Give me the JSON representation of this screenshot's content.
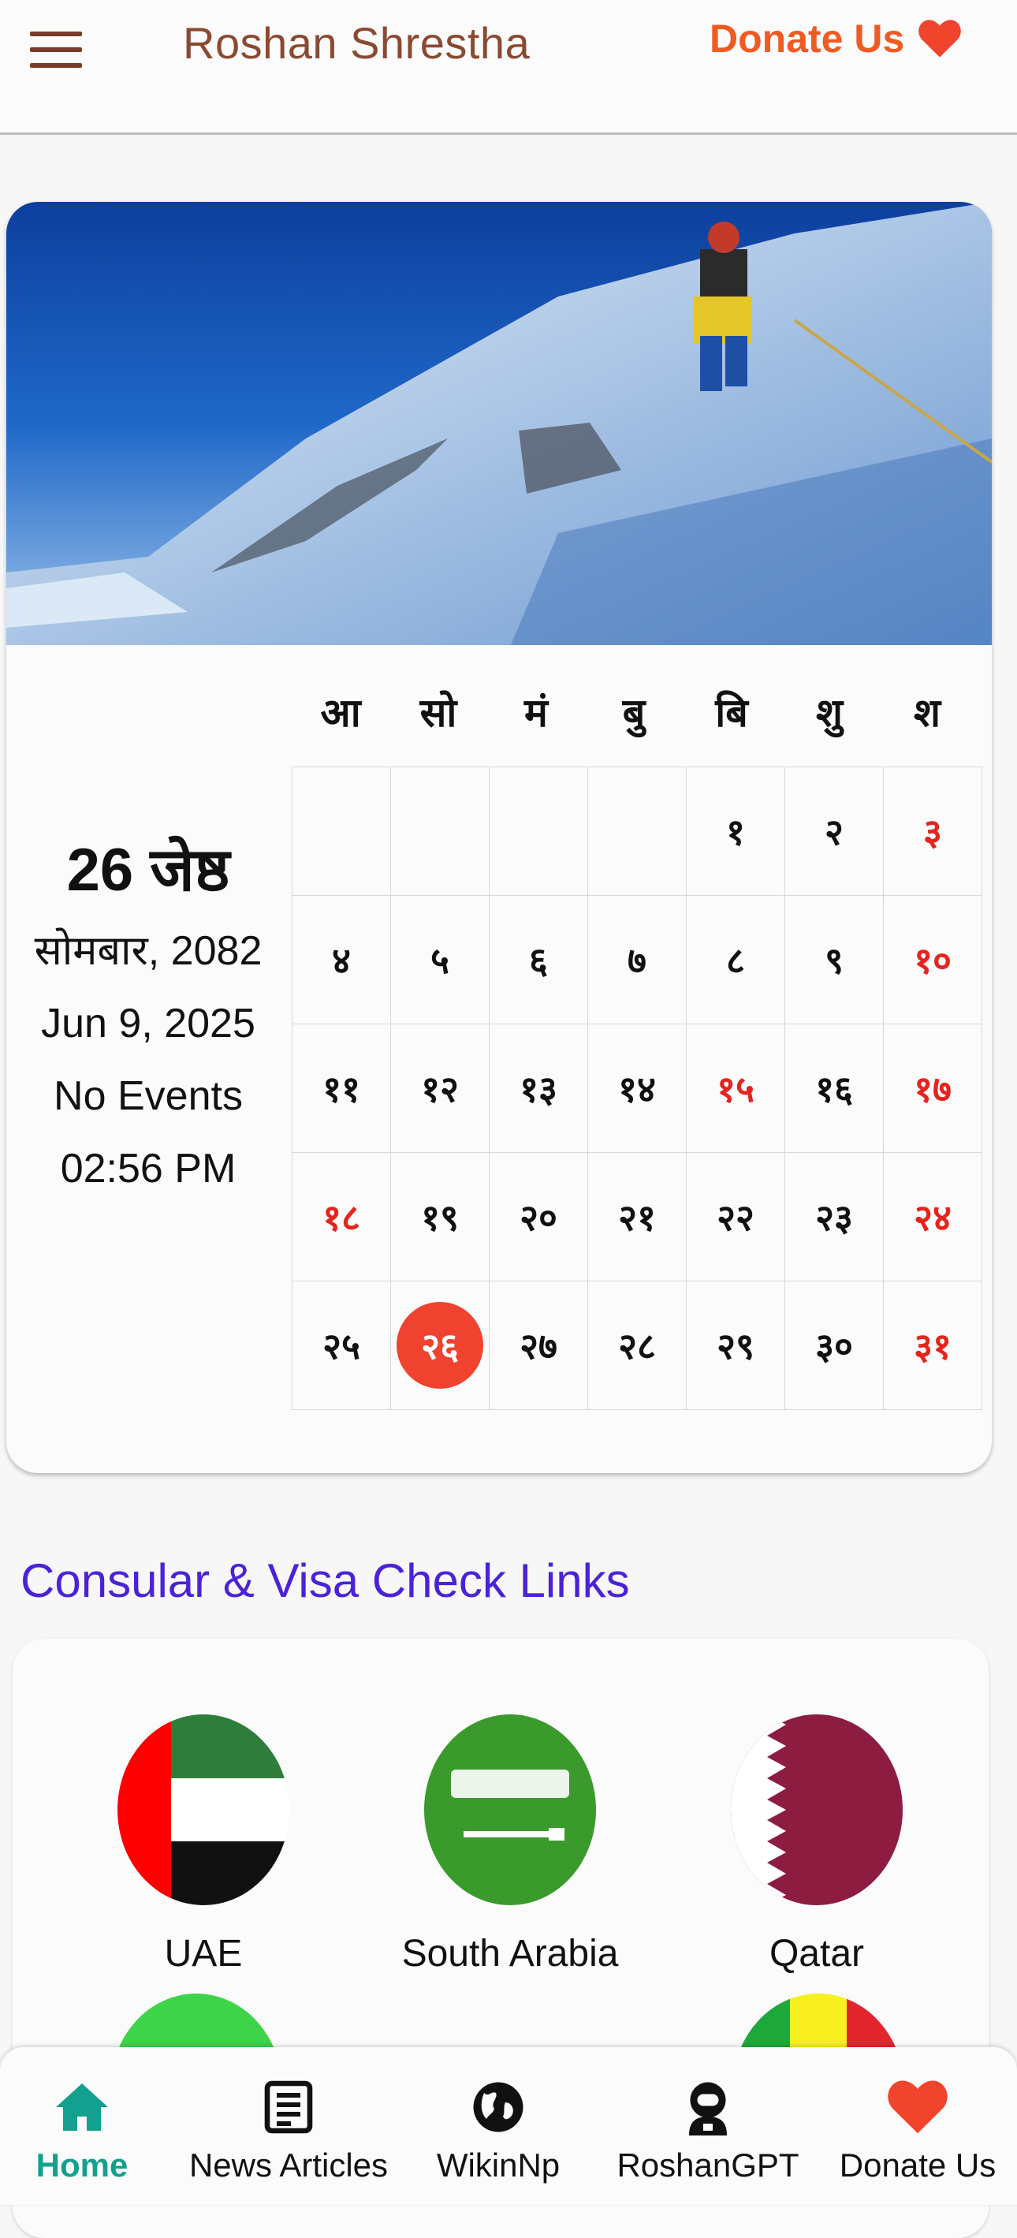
{
  "header": {
    "title": "Roshan Shrestha",
    "donate_label": "Donate Us",
    "menu_icon": "hamburger-icon",
    "heart_icon": "heart-icon"
  },
  "calendar": {
    "weekdays": [
      "आ",
      "सो",
      "मं",
      "बु",
      "बि",
      "शु",
      "श"
    ],
    "days": [
      [
        "",
        "",
        "",
        "",
        "१",
        "२",
        "३"
      ],
      [
        "४",
        "५",
        "६",
        "७",
        "८",
        "९",
        "१०"
      ],
      [
        "११",
        "१२",
        "१३",
        "१४",
        "१५",
        "१६",
        "१७"
      ],
      [
        "१८",
        "१९",
        "२०",
        "२१",
        "२२",
        "२३",
        "२४"
      ],
      [
        "२५",
        "२६",
        "२७",
        "२८",
        "२९",
        "३०",
        "३१"
      ]
    ],
    "holidays": [
      "३",
      "१०",
      "१५",
      "१७",
      "१८",
      "२४",
      "३१"
    ],
    "today": "२६",
    "selected": {
      "date": "26 जेष्ठ",
      "weekday_year": "सोमबार, 2082",
      "gregorian": "Jun 9, 2025",
      "events": "No Events",
      "time": "02:56 PM"
    },
    "colors": {
      "holiday": "#e5241e",
      "today_bg": "#f0432f"
    }
  },
  "consular": {
    "title": "Consular & Visa Check Links",
    "countries": [
      {
        "name": "UAE",
        "icon": "uae-flag-icon"
      },
      {
        "name": "South Arabia",
        "icon": "saudi-flag-icon"
      },
      {
        "name": "Qatar",
        "icon": "qatar-flag-icon"
      }
    ]
  },
  "bottom_nav": [
    {
      "label": "Home",
      "icon": "home-icon",
      "active": true
    },
    {
      "label": "News Articles",
      "icon": "article-icon",
      "active": false
    },
    {
      "label": "WikinNp",
      "icon": "globe-icon",
      "active": false
    },
    {
      "label": "RoshanGPT",
      "icon": "astronaut-icon",
      "active": false
    },
    {
      "label": "Donate Us",
      "icon": "heart-icon",
      "active": false
    }
  ],
  "colors": {
    "brand": "#8a4a32",
    "donate": "#f05a23",
    "section_title": "#4a22d8",
    "nav_active": "#14a08f"
  }
}
